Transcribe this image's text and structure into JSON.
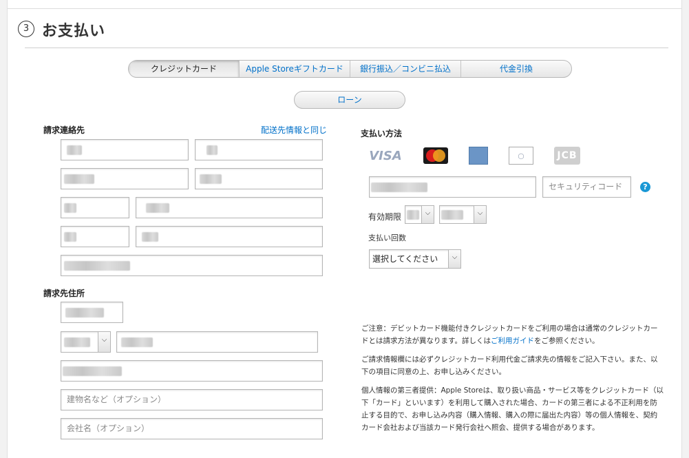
{
  "header": {
    "step_number": "3",
    "title": "お支払い"
  },
  "payment_tabs": [
    {
      "label": "クレジットカード",
      "active": true
    },
    {
      "label": "Apple Storeギフトカード",
      "active": false
    },
    {
      "label": "銀行振込／コンビニ払込",
      "active": false
    },
    {
      "label": "代金引換",
      "active": false
    }
  ],
  "loan_button": "ローン",
  "billing_contact": {
    "heading": "請求連絡先",
    "same_as_shipping_link": "配送先情報と同じ"
  },
  "billing_address": {
    "heading": "請求先住所",
    "building_placeholder": "建物名など（オプション）",
    "company_placeholder": "会社名（オプション）"
  },
  "payment_method": {
    "heading": "支払い方法",
    "card_brands": [
      "VISA",
      "MasterCard",
      "AMERICAN EXPRESS",
      "Diners Club",
      "JCB"
    ],
    "security_code_placeholder": "セキュリティコード",
    "help_icon": "?",
    "expiry_label": "有効期限",
    "installments_label": "支払い回数",
    "installments_value": "選択してください"
  },
  "notes": {
    "note1_prefix": "ご注意：デビットカード機能付きクレジットカードをご利用の場合は通常のクレジットカードとは請求方法が異なります。詳しくは",
    "note1_link": "ご利用ガイド",
    "note1_suffix": "をご参照ください。",
    "note2": "ご請求情報欄には必ずクレジットカード利用代金ご請求先の情報をご記入下さい。また、以下の項目に同意の上、お申し込みください。",
    "note3": "個人情報の第三者提供：Apple Storeは、取り扱い商品・サービス等をクレジットカード（以下「カード」といいます）を利用して購入された場合、カードの第三者による不正利用を防止する目的で、お申し込み内容（購入情報、購入の際に届出た内容）等の個人情報を、契約カード会社および当該カード発行会社へ照会、提供する場合があります。"
  },
  "colors": {
    "link": "#0070c9",
    "help_icon": "#1a98d5"
  }
}
